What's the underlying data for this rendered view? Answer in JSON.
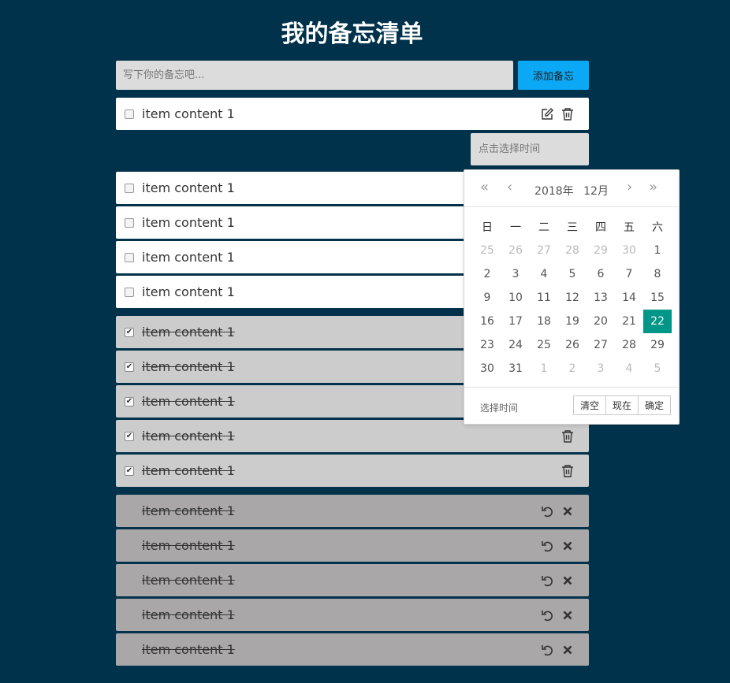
{
  "title": "我的备忘清单",
  "input": {
    "placeholder": "写下你的备忘吧...",
    "value": ""
  },
  "add_button": "添加备忘",
  "todo_items": [
    {
      "text": "item content 1",
      "editing": true
    },
    {
      "text": "item content 1"
    },
    {
      "text": "item content 1"
    },
    {
      "text": "item content 1"
    },
    {
      "text": "item content 1"
    }
  ],
  "time_input": {
    "placeholder": "点击选择时间",
    "value": ""
  },
  "done_items": [
    {
      "text": "item content 1"
    },
    {
      "text": "item content 1"
    },
    {
      "text": "item content 1"
    },
    {
      "text": "item content 1"
    },
    {
      "text": "item content 1"
    }
  ],
  "deleted_items": [
    {
      "text": "item content 1"
    },
    {
      "text": "item content 1"
    },
    {
      "text": "item content 1"
    },
    {
      "text": "item content 1"
    },
    {
      "text": "item content 1"
    }
  ],
  "calendar": {
    "year_label": "2018年",
    "month_label": "12月",
    "nav": {
      "prev_year": "«",
      "prev_month": "‹",
      "next_month": "›",
      "next_year": "»"
    },
    "weekdays": [
      "日",
      "一",
      "二",
      "三",
      "四",
      "五",
      "六"
    ],
    "weeks": [
      [
        "25",
        "26",
        "27",
        "28",
        "29",
        "30",
        "1"
      ],
      [
        "2",
        "3",
        "4",
        "5",
        "6",
        "7",
        "8"
      ],
      [
        "9",
        "10",
        "11",
        "12",
        "13",
        "14",
        "15"
      ],
      [
        "16",
        "17",
        "18",
        "19",
        "20",
        "21",
        "22"
      ],
      [
        "23",
        "24",
        "25",
        "26",
        "27",
        "28",
        "29"
      ],
      [
        "30",
        "31",
        "1",
        "2",
        "3",
        "4",
        "5"
      ]
    ],
    "selected_day": "22",
    "select_time": "选择时间",
    "buttons": {
      "clear": "清空",
      "now": "现在",
      "confirm": "确定"
    }
  },
  "colors": {
    "background": "#00324b",
    "add_button": "#0ba8f5",
    "selected_day": "#009688",
    "done_item": "#cccccc",
    "deleted_item": "#a9a7a8"
  },
  "icons": {
    "edit": "edit-icon",
    "delete": "trash-icon",
    "restore": "undo-icon",
    "remove": "close-icon"
  }
}
